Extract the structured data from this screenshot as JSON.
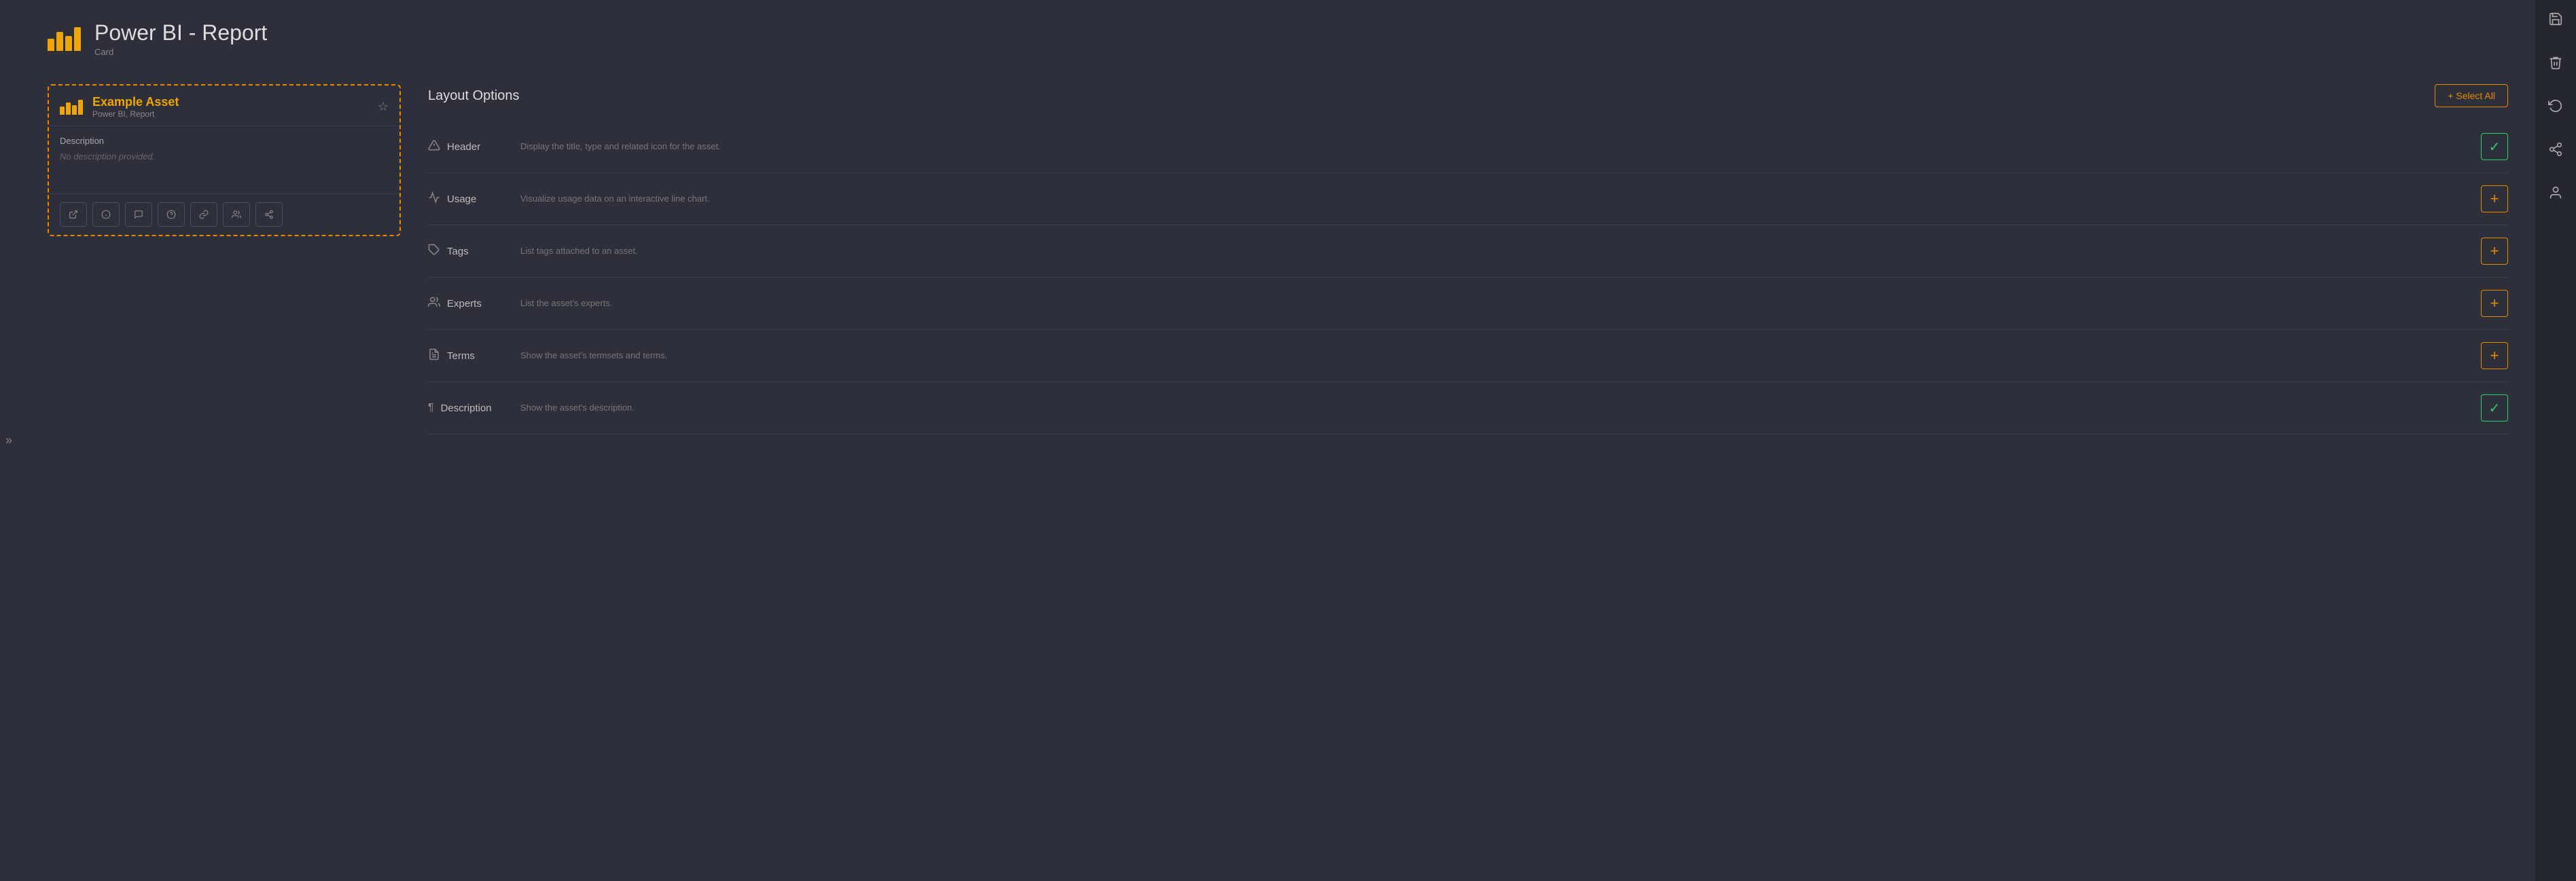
{
  "page": {
    "title": "Power BI - Report",
    "subtitle": "Card"
  },
  "header": {
    "icon_bars": [
      18,
      28,
      22,
      35
    ],
    "title": "Power BI - Report",
    "subtitle": "Card"
  },
  "asset_card": {
    "name": "Example Asset",
    "type": "Power BI, Report",
    "description_label": "Description",
    "description_text": "No description provided.",
    "actions": [
      {
        "icon": "↗",
        "name": "open-action",
        "label": "Open"
      },
      {
        "icon": "ℹ",
        "name": "info-action",
        "label": "Info"
      },
      {
        "icon": "💬",
        "name": "comment-action",
        "label": "Comment"
      },
      {
        "icon": "?",
        "name": "help-action",
        "label": "Help"
      },
      {
        "icon": "🔗",
        "name": "link-action",
        "label": "Link"
      },
      {
        "icon": "👥",
        "name": "users-action",
        "label": "Users"
      },
      {
        "icon": "⤴",
        "name": "share-action",
        "label": "Share"
      }
    ]
  },
  "layout_options": {
    "title": "Layout Options",
    "select_all_label": "+ Select All",
    "items": [
      {
        "id": "header",
        "icon": "⚠",
        "name": "Header",
        "description": "Display the title, type and related icon for the asset.",
        "active": true
      },
      {
        "id": "usage",
        "icon": "📈",
        "name": "Usage",
        "description": "Visualize usage data on an interactive line chart.",
        "active": false
      },
      {
        "id": "tags",
        "icon": "🏷",
        "name": "Tags",
        "description": "List tags attached to an asset.",
        "active": false
      },
      {
        "id": "experts",
        "icon": "👥",
        "name": "Experts",
        "description": "List the asset's experts.",
        "active": false
      },
      {
        "id": "terms",
        "icon": "📋",
        "name": "Terms",
        "description": "Show the asset's termsets and terms.",
        "active": false
      },
      {
        "id": "description",
        "icon": "¶",
        "name": "Description",
        "description": "Show the asset's description.",
        "active": true
      }
    ]
  },
  "right_sidebar": {
    "icons": [
      {
        "name": "save-icon",
        "glyph": "💾"
      },
      {
        "name": "delete-icon",
        "glyph": "🗑"
      },
      {
        "name": "undo-icon",
        "glyph": "↩"
      },
      {
        "name": "share-icon",
        "glyph": "⤴"
      },
      {
        "name": "user-icon",
        "glyph": "👤"
      }
    ]
  },
  "left_collapse": {
    "icon": "»"
  }
}
